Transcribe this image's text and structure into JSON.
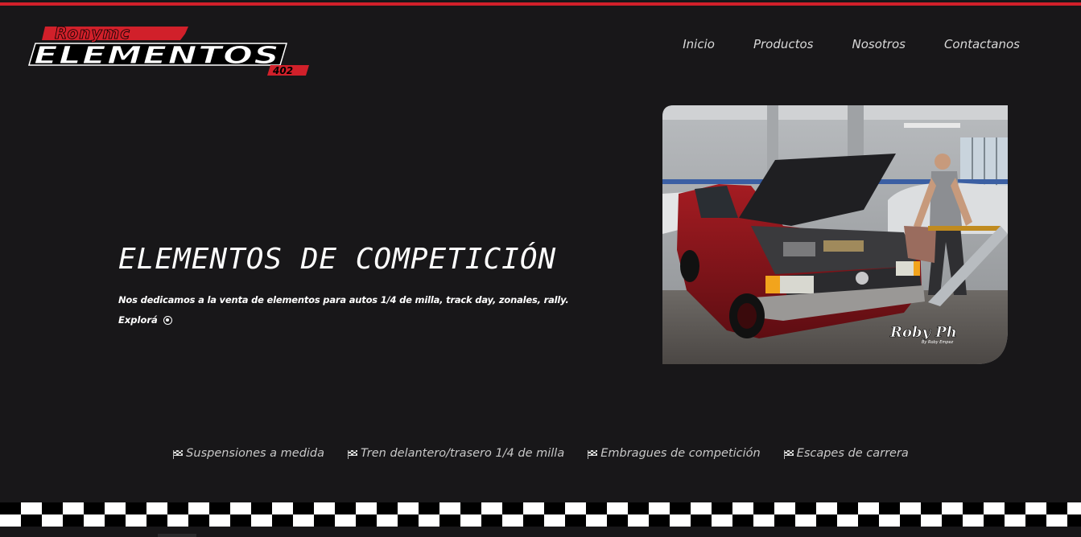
{
  "brand": {
    "logo_top": "Ronymc",
    "logo_main": "ELEMENTOS",
    "logo_sub": "402",
    "accent": "#d1202a"
  },
  "nav": {
    "items": [
      "Inicio",
      "Productos",
      "Nosotros",
      "Contactanos"
    ]
  },
  "hero": {
    "title": "ELEMENTOS DE COMPETICIÓN",
    "description": "Nos dedicamos a la venta de elementos para autos 1/4 de milla, track day, zonales, rally.",
    "explore_label": "Explorá",
    "image_watermark": "Roby Ph",
    "image_watermark_sub": "By Roby Empez"
  },
  "services": [
    "Suspensiones a medida",
    "Tren delantero/trasero 1/4 de milla",
    "Embragues de competición",
    "Escapes de carrera"
  ],
  "colors": {
    "background": "#181719",
    "text": "#ffffff",
    "nav_text": "#d9d9d9",
    "service_text": "#c8c8c8"
  }
}
